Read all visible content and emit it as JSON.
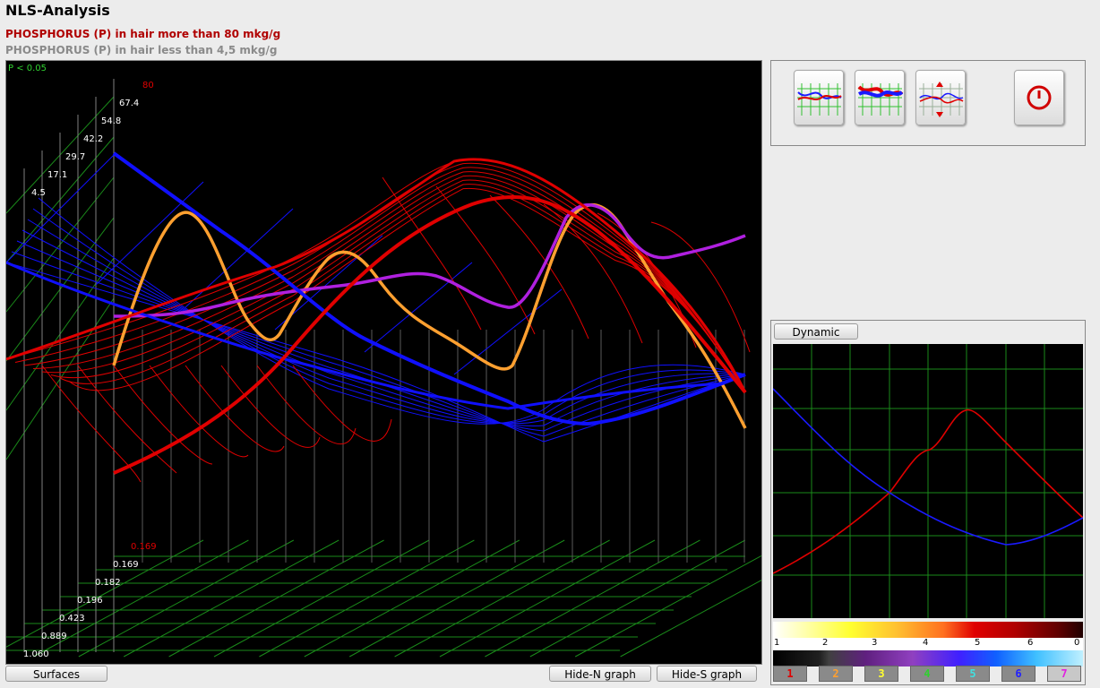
{
  "app": {
    "title": "NLS-Analysis"
  },
  "header": {
    "line1": "PHOSPHORUS (P) in hair more than 80 mkg/g",
    "line2": "PHOSPHORUS (P) in hair less than 4,5 mkg/g"
  },
  "main_chart": {
    "significance": "P < 0.05",
    "y_top_label": "80",
    "y_labels": [
      "67.4",
      "54.8",
      "42.2",
      "29.7",
      "17.1",
      "4.5"
    ],
    "z_top_label": "0.169",
    "z_labels": [
      "0.169",
      "0.182",
      "0.196",
      "0.423",
      "0.889",
      "1.060"
    ],
    "colors": {
      "high": "#e00000",
      "low": "#1010ff",
      "orange": "#ffa030",
      "violet": "#b020e0",
      "grid": "#1a8a1a"
    }
  },
  "buttons": {
    "surfaces": "Surfaces",
    "hide_n": "Hide-N graph",
    "hide_s": "Hide-S graph",
    "dynamic": "Dynamic"
  },
  "toolbar": {
    "tools": [
      "graph-lines-icon",
      "thick-graph-icon",
      "spread-graph-icon",
      "power-icon"
    ]
  },
  "dynamic_chart": {
    "scale_labels": [
      "1",
      "2",
      "3",
      "4",
      "5",
      "6",
      "0"
    ]
  },
  "series": [
    {
      "label": "1",
      "color": "#e00000"
    },
    {
      "label": "2",
      "color": "#ffa030"
    },
    {
      "label": "3",
      "color": "#ffff30"
    },
    {
      "label": "4",
      "color": "#30d030"
    },
    {
      "label": "5",
      "color": "#40e0e0"
    },
    {
      "label": "6",
      "color": "#2020ff"
    },
    {
      "label": "7",
      "color": "#e020e0"
    }
  ]
}
